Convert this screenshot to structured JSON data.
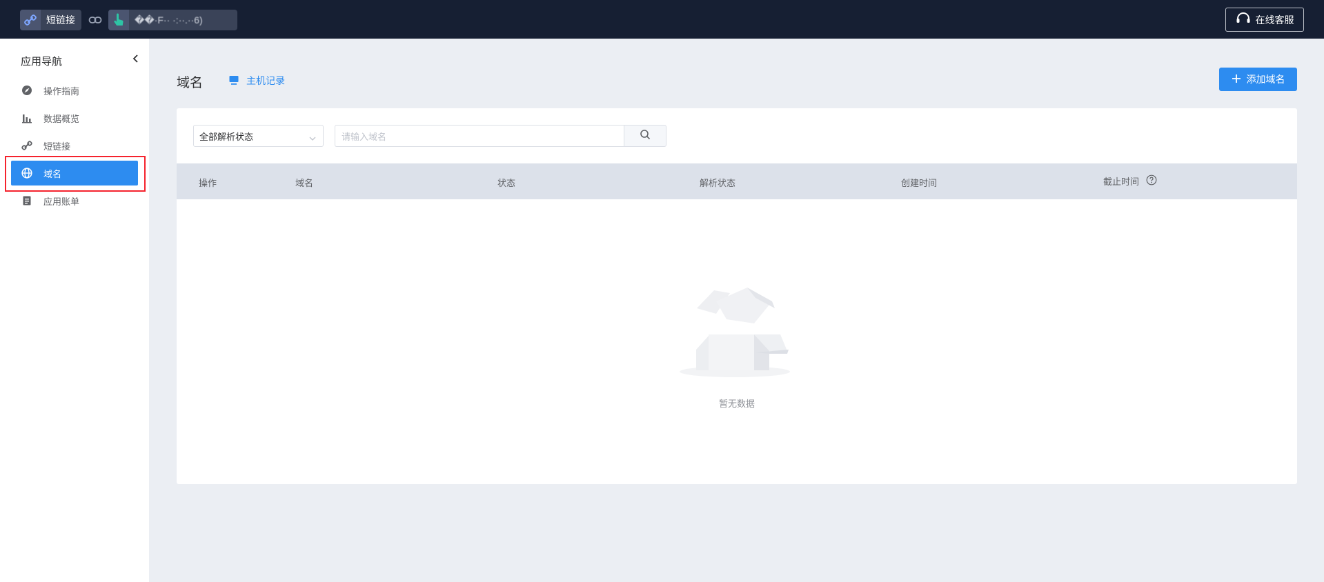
{
  "header": {
    "app_label": "短链接",
    "account_label": "��·F··  ·:··.··6)",
    "service_label": "在线客服"
  },
  "sidebar": {
    "title": "应用导航",
    "items": [
      {
        "label": "操作指南",
        "icon": "compass-icon"
      },
      {
        "label": "数据概览",
        "icon": "bar-chart-icon"
      },
      {
        "label": "短链接",
        "icon": "link-icon"
      },
      {
        "label": "域名",
        "icon": "globe-icon",
        "active": true
      },
      {
        "label": "应用账单",
        "icon": "bill-icon"
      }
    ]
  },
  "main": {
    "title": "域名",
    "host_link": "主机记录",
    "add_button": "添加域名",
    "filter": {
      "selected": "全部解析状态"
    },
    "search": {
      "placeholder": "请输入域名"
    },
    "table": {
      "columns": [
        "操作",
        "域名",
        "状态",
        "解析状态",
        "创建时间",
        "截止时间"
      ],
      "rows": []
    },
    "empty_text": "暂无数据"
  },
  "colors": {
    "topbar": "#161f33",
    "accent": "#2d8cf0",
    "highlight": "#f5222d",
    "table_header": "#dce1ea"
  }
}
